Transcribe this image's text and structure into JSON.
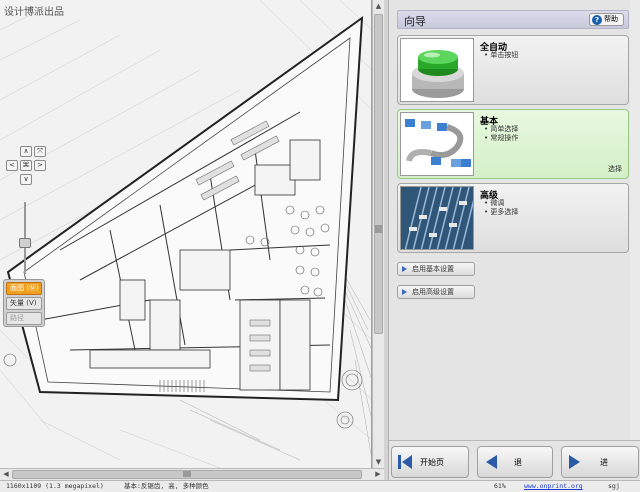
{
  "viewer": {
    "watermark": "设计博派出品",
    "nav": {
      "up": "∧",
      "down": "∨",
      "left": "<",
      "right": ">",
      "center": "⌘",
      "fit": "⤧"
    },
    "view_modes": [
      {
        "label": "面图 (Ⓜ)",
        "active": true
      },
      {
        "label": "矢量 (V)",
        "active": false
      },
      {
        "label": "路径",
        "active": false,
        "disabled": true
      }
    ]
  },
  "panel": {
    "title": "向导",
    "help_label": "帮助",
    "cards": [
      {
        "title": "全自动",
        "bullets": [
          "单击按钮"
        ],
        "thumb": "green-button-icon",
        "select_label": ""
      },
      {
        "title": "基本",
        "bullets": [
          "简单选择",
          "常规操作"
        ],
        "thumb": "workflow-diagram-icon",
        "select_label": "选择",
        "selected": true
      },
      {
        "title": "高级",
        "bullets": [
          "微调",
          "更多选择"
        ],
        "thumb": "mixer-faders-icon",
        "select_label": ""
      }
    ],
    "advanced_buttons": [
      "启用基本设置",
      "启用高级设置"
    ],
    "footer": {
      "home": "开始页",
      "back": "退",
      "next": "进"
    }
  },
  "statusbar": {
    "dimensions": "1160x1109 (1.3 megapixel)",
    "mode": "基本:反锯齿, 高, 多种颜色",
    "zoom": "61%",
    "url": "www.onprint.org",
    "user": "sgj"
  }
}
